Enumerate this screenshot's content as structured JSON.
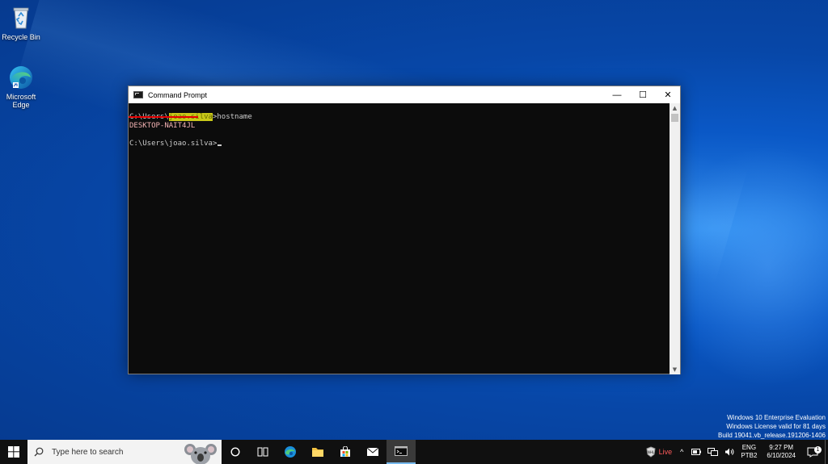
{
  "desktop": {
    "icons": [
      {
        "label": "Recycle Bin",
        "icon": "recycle-bin-icon"
      },
      {
        "label": "Microsoft Edge",
        "icon": "edge-icon"
      }
    ],
    "watermark": {
      "line1": "Windows 10 Enterprise Evaluation",
      "line2": "Windows License valid for 81 days",
      "line3": "Build 19041.vb_release.191206-1406"
    }
  },
  "window": {
    "title": "Command Prompt",
    "controls": {
      "minimize": "—",
      "maximize": "☐",
      "close": "✕"
    },
    "console": {
      "line1_prefix": "C:\\Users\\",
      "line1_user": "joao.silva",
      "line1_suffix": ">hostname",
      "line2": "DESKTOP-NAIT4JL",
      "line3": "C:\\Users\\joao.silva>"
    },
    "highlight_color": "#c9c919",
    "underline_color": "#e60000"
  },
  "taskbar": {
    "search_placeholder": "Type here to search",
    "live_label": "Live",
    "lang_top": "ENG",
    "lang_bottom": "PTB2",
    "time": "9:27 PM",
    "date": "6/10/2024",
    "notification_count": "1",
    "accent": "#76b9ed"
  }
}
